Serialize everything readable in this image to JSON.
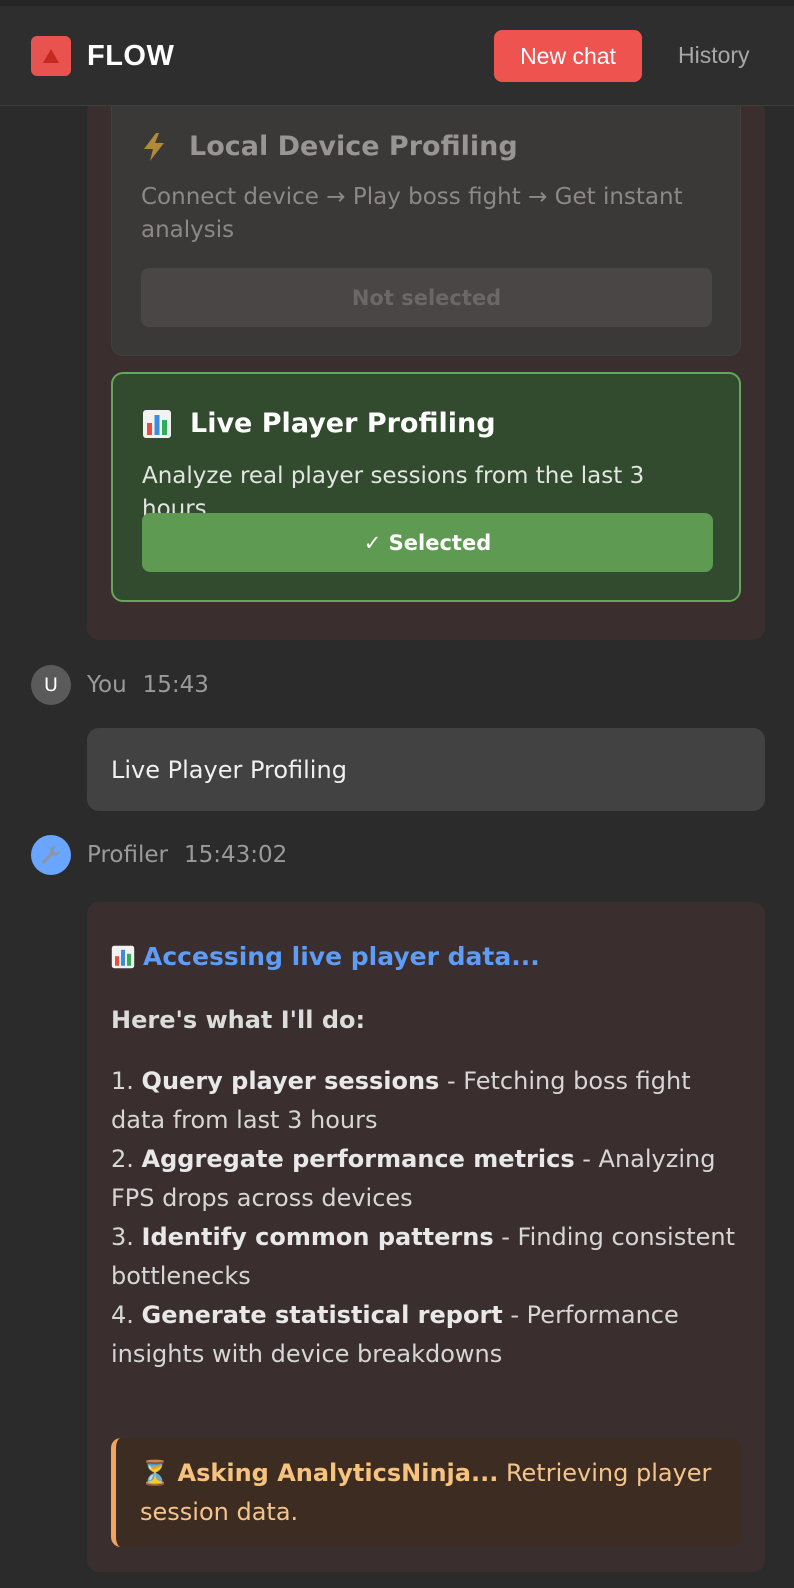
{
  "header": {
    "brand": "FLOW",
    "new_chat_label": "New chat",
    "history_label": "History",
    "accent_color": "#ef5350"
  },
  "options": {
    "local": {
      "icon": "lightning-icon",
      "title": "Local Device Profiling",
      "description": "Connect device → Play boss fight → Get instant analysis",
      "button_label": "Not selected"
    },
    "live": {
      "icon": "bar-chart-icon",
      "title": "Live Player Profiling",
      "description": "Analyze real player sessions from the last 3 hours",
      "button_label": "✓ Selected",
      "accent_color": "#64a65a"
    }
  },
  "user_message": {
    "avatar_letter": "U",
    "author": "You",
    "time": "15:43",
    "text": "Live Player Profiling"
  },
  "bot_message": {
    "avatar_icon": "wrench-icon",
    "author": "Profiler",
    "time": "15:43:02",
    "status": "Accessing live player data...",
    "status_icon": "bar-chart-icon",
    "plan_heading": "Here's what I'll do:",
    "steps": [
      {
        "num": "1.",
        "title": "Query player sessions",
        "desc": " - Fetching boss fight data from last 3 hours"
      },
      {
        "num": "2.",
        "title": "Aggregate performance metrics",
        "desc": " - Analyzing FPS drops across devices"
      },
      {
        "num": "3.",
        "title": "Identify common patterns",
        "desc": " - Finding consistent bottlenecks"
      },
      {
        "num": "4.",
        "title": "Generate statistical report",
        "desc": " - Performance insights with device breakdowns"
      }
    ],
    "notice": {
      "icon": "hourglass-icon",
      "title": "Asking AnalyticsNinja...",
      "text": " Retrieving player session data.",
      "accent_color": "#f0a45c"
    }
  }
}
